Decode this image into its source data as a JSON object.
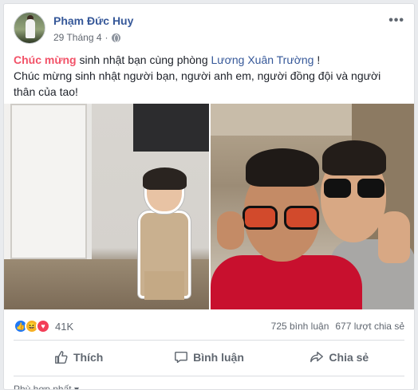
{
  "post": {
    "author": "Phạm Đức Huy",
    "date": "29 Tháng 4",
    "date_sep": "·",
    "more": "•••",
    "text": {
      "line1_prefix": "Chúc mừng",
      "line1_mid": " sinh nhật bạn cùng phòng ",
      "line1_name": "Lương Xuân Trường",
      "line1_suffix": " !",
      "line2": "Chúc mừng sinh nhật người bạn, người anh em, người đồng đội và người thân của tao!"
    }
  },
  "reactions": {
    "icons": [
      "like-icon",
      "haha-icon",
      "love-icon"
    ],
    "count": "41K",
    "comments": "725 bình luận",
    "shares": "677 lượt chia sẻ"
  },
  "actions": {
    "like": "Thích",
    "comment": "Bình luận",
    "share": "Chia sẻ"
  },
  "sort": {
    "label": "Phù hợp nhất",
    "arrow": "▾"
  },
  "colors": {
    "link_blue": "#365899",
    "highlight_red": "#f25268",
    "like_blue": "#2078f4",
    "love_red": "#f33e58",
    "haha_yellow": "#f7b125"
  }
}
